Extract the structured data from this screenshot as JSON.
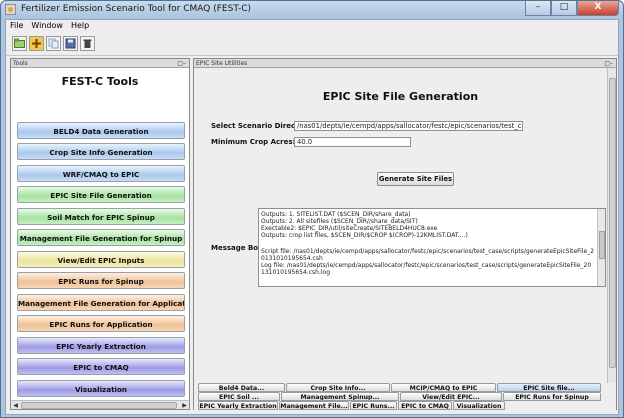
{
  "window": {
    "title": "Fertilizer Emission Scenario Tool for CMAQ (FEST-C)",
    "minimize": "–",
    "maximize": "□",
    "close": "X"
  },
  "menu": [
    "File",
    "Window",
    "Help"
  ],
  "toolbar": {
    "icons": [
      "open-folder-icon",
      "add-icon",
      "copy-icon",
      "save-icon",
      "trash-icon"
    ]
  },
  "tools_panel": {
    "header": "Tools",
    "title": "FEST-C Tools",
    "buttons": [
      {
        "label": "BELD4 Data Generation",
        "color": "blue"
      },
      {
        "label": "Crop Site Info Generation",
        "color": "blue"
      },
      {
        "label": "WRF/CMAQ to EPIC",
        "color": "blue"
      },
      {
        "label": "EPIC Site File Generation",
        "color": "green"
      },
      {
        "label": "Soil Match for EPIC Spinup",
        "color": "green"
      },
      {
        "label": "Management File Generation for Spinup",
        "color": "green"
      },
      {
        "label": "View/Edit EPIC Inputs",
        "color": "yellow"
      },
      {
        "label": "EPIC Runs for Spinup",
        "color": "orange"
      },
      {
        "label": "Management File Generation for Applicat...",
        "color": "orange"
      },
      {
        "label": "EPIC Runs for Application",
        "color": "orange"
      },
      {
        "label": "EPIC Yearly Extraction",
        "color": "purple"
      },
      {
        "label": "EPIC to CMAQ",
        "color": "purple"
      },
      {
        "label": "Visualization",
        "color": "purple"
      }
    ]
  },
  "main_panel": {
    "header": "EPIC Site Utilities",
    "title": "EPIC Site File Generation",
    "scenario_label": "Select Scenario Direcotry:",
    "scenario_value": "/nas01/depts/ie/cempd/apps/sallocator/festc/epic/scenarios/test_case",
    "crop_label": "Minimum Crop Acres:",
    "crop_value": "40.0",
    "generate_button": "Generate Site Files",
    "message_label": "Message Box:",
    "messages": [
      "Outputs: 1. SITELIST.DAT  ($SCEN_DIR/share_data)",
      "Outputs: 2. All sitefiles ($SCEN_DIR//share_data/SIT)",
      "Exectable2: $EPIC_DIR/util/siteCreate/SITEBELD4HUC8.exe",
      "Outputs: crop list files, $SCEN_DIR/$CROP $(CROP)-12KMLIST.DAT....)",
      "",
      "Script file: /nas01/depts/ie/cempd/apps/sallocator/festc/epic/scenarios/test_case/scripts/generateEpicSiteFile_2",
      "0131010195654.csh",
      "Log file: /nas01/depts/ie/cempd/apps/sallocator/festc/epic/scenarios/test_case/scripts/generateEpicSiteFile_20",
      "131010195654.csh.log"
    ]
  },
  "tabs": {
    "row1": [
      "Beld4 Data...",
      "Crop Site Info...",
      "MCIP/CMAQ to EPIC",
      "EPIC Site file..."
    ],
    "row2": [
      "EPIC Soil ...",
      "Management Spinup...",
      "View/Edit EPIC...",
      "EPIC Runs for Spinup"
    ],
    "row3": [
      "EPIC Yearly Extraction",
      "Management File...",
      "EPIC Runs...",
      "EPIC to CMAQ",
      "Visualization"
    ]
  }
}
